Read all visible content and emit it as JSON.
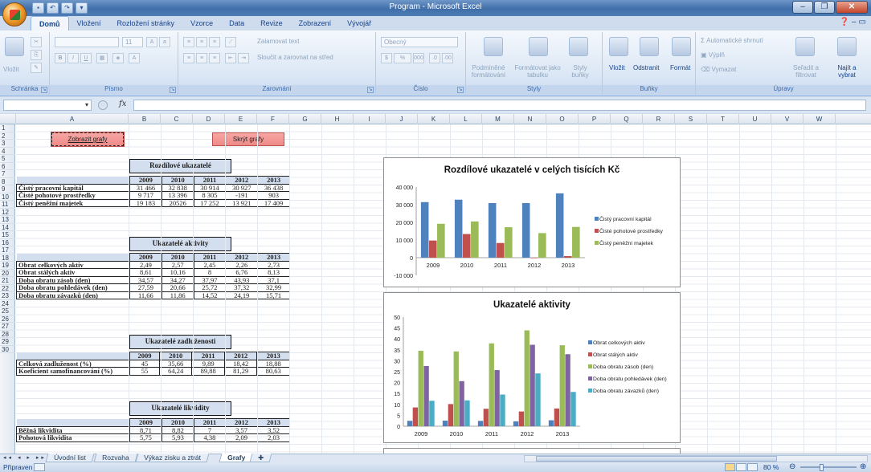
{
  "window": {
    "title": "Program - Microsoft Excel"
  },
  "ribbon_tabs": [
    "Domů",
    "Vložení",
    "Rozložení stránky",
    "Vzorce",
    "Data",
    "Revize",
    "Zobrazení",
    "Vývojář"
  ],
  "ribbon": {
    "clipboard": {
      "paste": "Vložit",
      "label": "Schránka"
    },
    "font": {
      "size": "11",
      "label": "Písmo"
    },
    "alignment": {
      "wrap": "Zalamovat text",
      "merge": "Sloučit a zarovnat na střed",
      "label": "Zarovnání"
    },
    "number": {
      "format": "Obecný",
      "label": "Číslo"
    },
    "styles": {
      "conditional": "Podmíněné formátování",
      "as_table": "Formátovat jako tabulku",
      "cell_styles": "Styly buňky",
      "label": "Styly"
    },
    "cells": {
      "insert": "Vložit",
      "delete": "Odstranit",
      "format": "Formát",
      "label": "Buňky"
    },
    "editing": {
      "autosum": "Automatické shrnutí",
      "fill": "Výplň",
      "clear": "Vymazat",
      "sort": "Seřadit a filtrovat",
      "find": "Najít a vybrat",
      "label": "Úpravy"
    }
  },
  "formula_bar": {
    "fx": "fx",
    "name_box": "",
    "content": ""
  },
  "columns": [
    "A",
    "B",
    "C",
    "D",
    "E",
    "F",
    "G",
    "H",
    "I",
    "J",
    "K",
    "L",
    "M",
    "N",
    "O",
    "P",
    "Q",
    "R",
    "S",
    "T",
    "U",
    "V",
    "W"
  ],
  "rows": [
    "1",
    "2",
    "3",
    "4",
    "5",
    "6",
    "7",
    "8",
    "9",
    "10",
    "11",
    "12",
    "13",
    "14",
    "15",
    "16",
    "17",
    "18",
    "19",
    "20",
    "21",
    "22",
    "23",
    "24",
    "25",
    "26",
    "27",
    "28",
    "29",
    "30"
  ],
  "buttons": {
    "show_charts": "Zobrazit grafy",
    "hide_charts": "Skrýt grafy"
  },
  "years": [
    "2009",
    "2010",
    "2011",
    "2012",
    "2013"
  ],
  "tables": {
    "rozdilove": {
      "title": "Rozdílové ukazatelé",
      "rows": [
        {
          "label": "Čistý pracovní kapitál",
          "values": [
            "31 466",
            "32 838",
            "30 914",
            "30 927",
            "36 438"
          ]
        },
        {
          "label": "Čisté pohotové prostředky",
          "values": [
            "9 717",
            "13 396",
            "8 305",
            "-191",
            "903"
          ]
        },
        {
          "label": "Čistý peněžní majetek",
          "values": [
            "19 183",
            "20526",
            "17 252",
            "13 921",
            "17 409"
          ]
        }
      ]
    },
    "aktivity": {
      "title": "Ukazatelé aktivity",
      "rows": [
        {
          "label": "Obrat celkových aktiv",
          "values": [
            "2,49",
            "2,57",
            "2,45",
            "2,26",
            "2,73"
          ]
        },
        {
          "label": "Obrat stálých aktiv",
          "values": [
            "8,61",
            "10,16",
            "8",
            "6,76",
            "8,13"
          ]
        },
        {
          "label": "Doba obratu zásob (den)",
          "values": [
            "34,57",
            "34,27",
            "37,97",
            "43,93",
            "37,1"
          ]
        },
        {
          "label": "Doba obratu pohledávek (den)",
          "values": [
            "27,59",
            "20,66",
            "25,72",
            "37,32",
            "32,99"
          ]
        },
        {
          "label": "Doba obratu závazků (den)",
          "values": [
            "11,66",
            "11,86",
            "14,52",
            "24,19",
            "15,71"
          ]
        }
      ]
    },
    "zadluzenosti": {
      "title": "Ukazatelé zadluženosti",
      "rows": [
        {
          "label": "Celková zadluženost (%)",
          "values": [
            "45",
            "35,66",
            "9,89",
            "18,42",
            "18,88"
          ]
        },
        {
          "label": "Koeficient samofinancování (%)",
          "values": [
            "55",
            "64,24",
            "89,88",
            "81,29",
            "80,63"
          ]
        }
      ]
    },
    "likvidity": {
      "title": "Ukazatelé likvidity",
      "rows": [
        {
          "label": "Běžná likvidita",
          "values": [
            "8,71",
            "8,82",
            "7",
            "3,57",
            "3,52"
          ]
        },
        {
          "label": "Pohotová likvidita",
          "values": [
            "5,75",
            "5,93",
            "4,38",
            "2,09",
            "2,03"
          ]
        }
      ]
    }
  },
  "chart_data": [
    {
      "type": "bar",
      "title": "Rozdílové ukazatelé v celých tisících Kč",
      "categories": [
        "2009",
        "2010",
        "2011",
        "2012",
        "2013"
      ],
      "ylim": [
        -10000,
        40000
      ],
      "yticks": [
        "-10 000",
        "0",
        "10 000",
        "20 000",
        "30 000",
        "40 000"
      ],
      "ytick_values": [
        -10000,
        0,
        10000,
        20000,
        30000,
        40000
      ],
      "legend": "right",
      "series": [
        {
          "name": "Čistý pracovní kapitál",
          "color": "#4f81bd",
          "values": [
            31466,
            32838,
            30914,
            30927,
            36438
          ]
        },
        {
          "name": "Čisté pohotové prostředky",
          "color": "#c0504d",
          "values": [
            9717,
            13396,
            8305,
            -191,
            903
          ]
        },
        {
          "name": "Čistý peněžní majetek",
          "color": "#9bbb59",
          "values": [
            19183,
            20526,
            17252,
            13921,
            17409
          ]
        }
      ]
    },
    {
      "type": "bar",
      "title": "Ukazatelé aktivity",
      "categories": [
        "2009",
        "2010",
        "2011",
        "2012",
        "2013"
      ],
      "ylim": [
        0,
        50
      ],
      "yticks": [
        "0",
        "5",
        "10",
        "15",
        "20",
        "25",
        "30",
        "35",
        "40",
        "45",
        "50"
      ],
      "ytick_values": [
        0,
        5,
        10,
        15,
        20,
        25,
        30,
        35,
        40,
        45,
        50
      ],
      "legend": "right",
      "series": [
        {
          "name": "Obrat celkových aktiv",
          "color": "#4f81bd",
          "values": [
            2.49,
            2.57,
            2.45,
            2.26,
            2.73
          ]
        },
        {
          "name": "Obrat stálých aktiv",
          "color": "#c0504d",
          "values": [
            8.61,
            10.16,
            8,
            6.76,
            8.13
          ]
        },
        {
          "name": "Doba obratu zásob (den)",
          "color": "#9bbb59",
          "values": [
            34.57,
            34.27,
            37.97,
            43.93,
            37.1
          ]
        },
        {
          "name": "Doba obratu pohledávek (den)",
          "color": "#8064a2",
          "values": [
            27.59,
            20.66,
            25.72,
            37.32,
            32.99
          ]
        },
        {
          "name": "Doba obratu závazků (den)",
          "color": "#4bacc6",
          "values": [
            11.66,
            11.86,
            14.52,
            24.19,
            15.71
          ]
        }
      ]
    }
  ],
  "sheet_tabs": [
    "Úvodní list",
    "Rozvaha",
    "Výkaz zisku a ztrát",
    "Grafy"
  ],
  "active_sheet": "Grafy",
  "status": {
    "text": "Připraven",
    "zoom": "80 %"
  }
}
